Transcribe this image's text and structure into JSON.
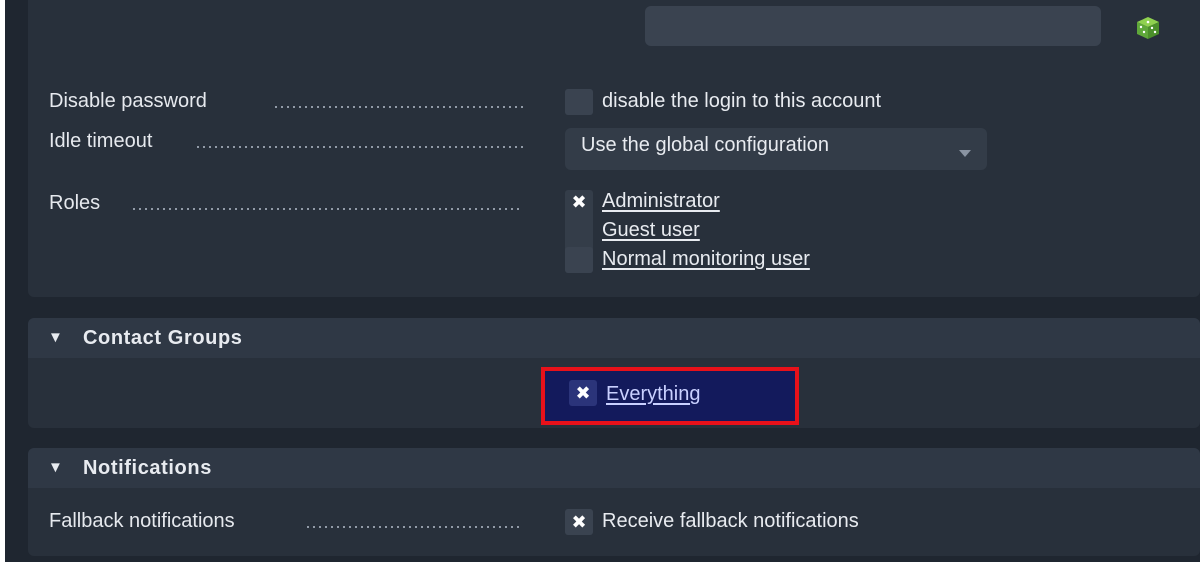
{
  "header": {
    "search_placeholder": "",
    "random_icon": "dice-icon"
  },
  "login": {
    "disable_password": {
      "label": "Disable password",
      "checkbox_label": "disable the login to this account",
      "checked": false
    },
    "idle_timeout": {
      "label": "Idle timeout",
      "selected": "Use the global configuration"
    },
    "roles": {
      "label": "Roles",
      "items": [
        {
          "label": "Administrator",
          "checked": true
        },
        {
          "label": "Guest user",
          "checked": false
        },
        {
          "label": "Normal monitoring user",
          "checked": false
        }
      ]
    }
  },
  "contact_groups": {
    "title": "Contact Groups",
    "items": [
      {
        "label": "Everything",
        "checked": true
      }
    ]
  },
  "notifications": {
    "title": "Notifications",
    "fallback": {
      "label": "Fallback notifications",
      "checkbox_label": "Receive fallback notifications",
      "checked": true
    }
  },
  "colors": {
    "background": "#1f2630",
    "panel": "#28303b",
    "highlight_border": "#e8111a",
    "highlight_fill": "#131a5c"
  }
}
